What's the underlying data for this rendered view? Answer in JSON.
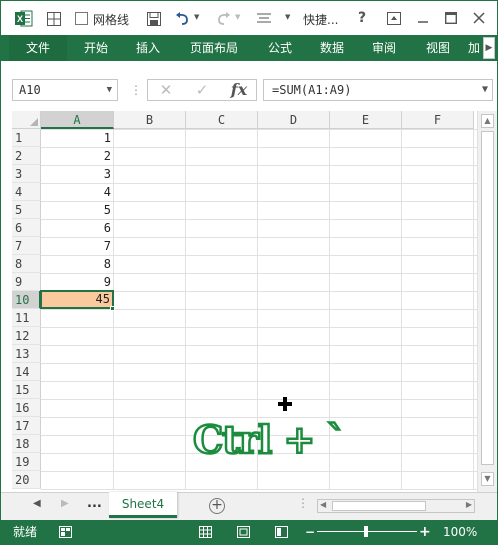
{
  "titlebar": {
    "gridlines_label": "网格线",
    "quick_label": "快捷...",
    "help": "?",
    "icons": [
      "excel-icon",
      "border-icon",
      "checkbox-icon",
      "save-icon",
      "undo-icon",
      "redo-icon",
      "align-icon",
      "minimize-icon",
      "restore-icon",
      "close-icon"
    ]
  },
  "ribbon": {
    "tabs": [
      "文件",
      "开始",
      "插入",
      "页面布局",
      "公式",
      "数据",
      "审阅",
      "视图"
    ],
    "overflow_tab": "加"
  },
  "formula_bar": {
    "name_box": "A10",
    "formula": "=SUM(A1:A9)",
    "fx": "fx"
  },
  "grid": {
    "columns": [
      "A",
      "B",
      "C",
      "D",
      "E",
      "F"
    ],
    "rows": [
      "1",
      "2",
      "3",
      "4",
      "5",
      "6",
      "7",
      "8",
      "9",
      "10",
      "11",
      "12",
      "13",
      "14",
      "15",
      "16",
      "17",
      "18",
      "19",
      "20"
    ],
    "column_a_values": [
      "1",
      "2",
      "3",
      "4",
      "5",
      "6",
      "7",
      "8",
      "9",
      "45"
    ],
    "selected_column": "A",
    "selected_row": "10"
  },
  "sheets": {
    "active": "Sheet4",
    "ellipsis": "...",
    "add": "+"
  },
  "status": {
    "ready": "就绪",
    "zoom": "100%",
    "minus": "−",
    "plus": "+"
  },
  "overlay": {
    "shortcut": "Ctrl + `"
  },
  "colors": {
    "excel_green": "#217346",
    "active_cell_fill": "#fbc99e",
    "overlay_stroke": "#1b8c3e"
  }
}
